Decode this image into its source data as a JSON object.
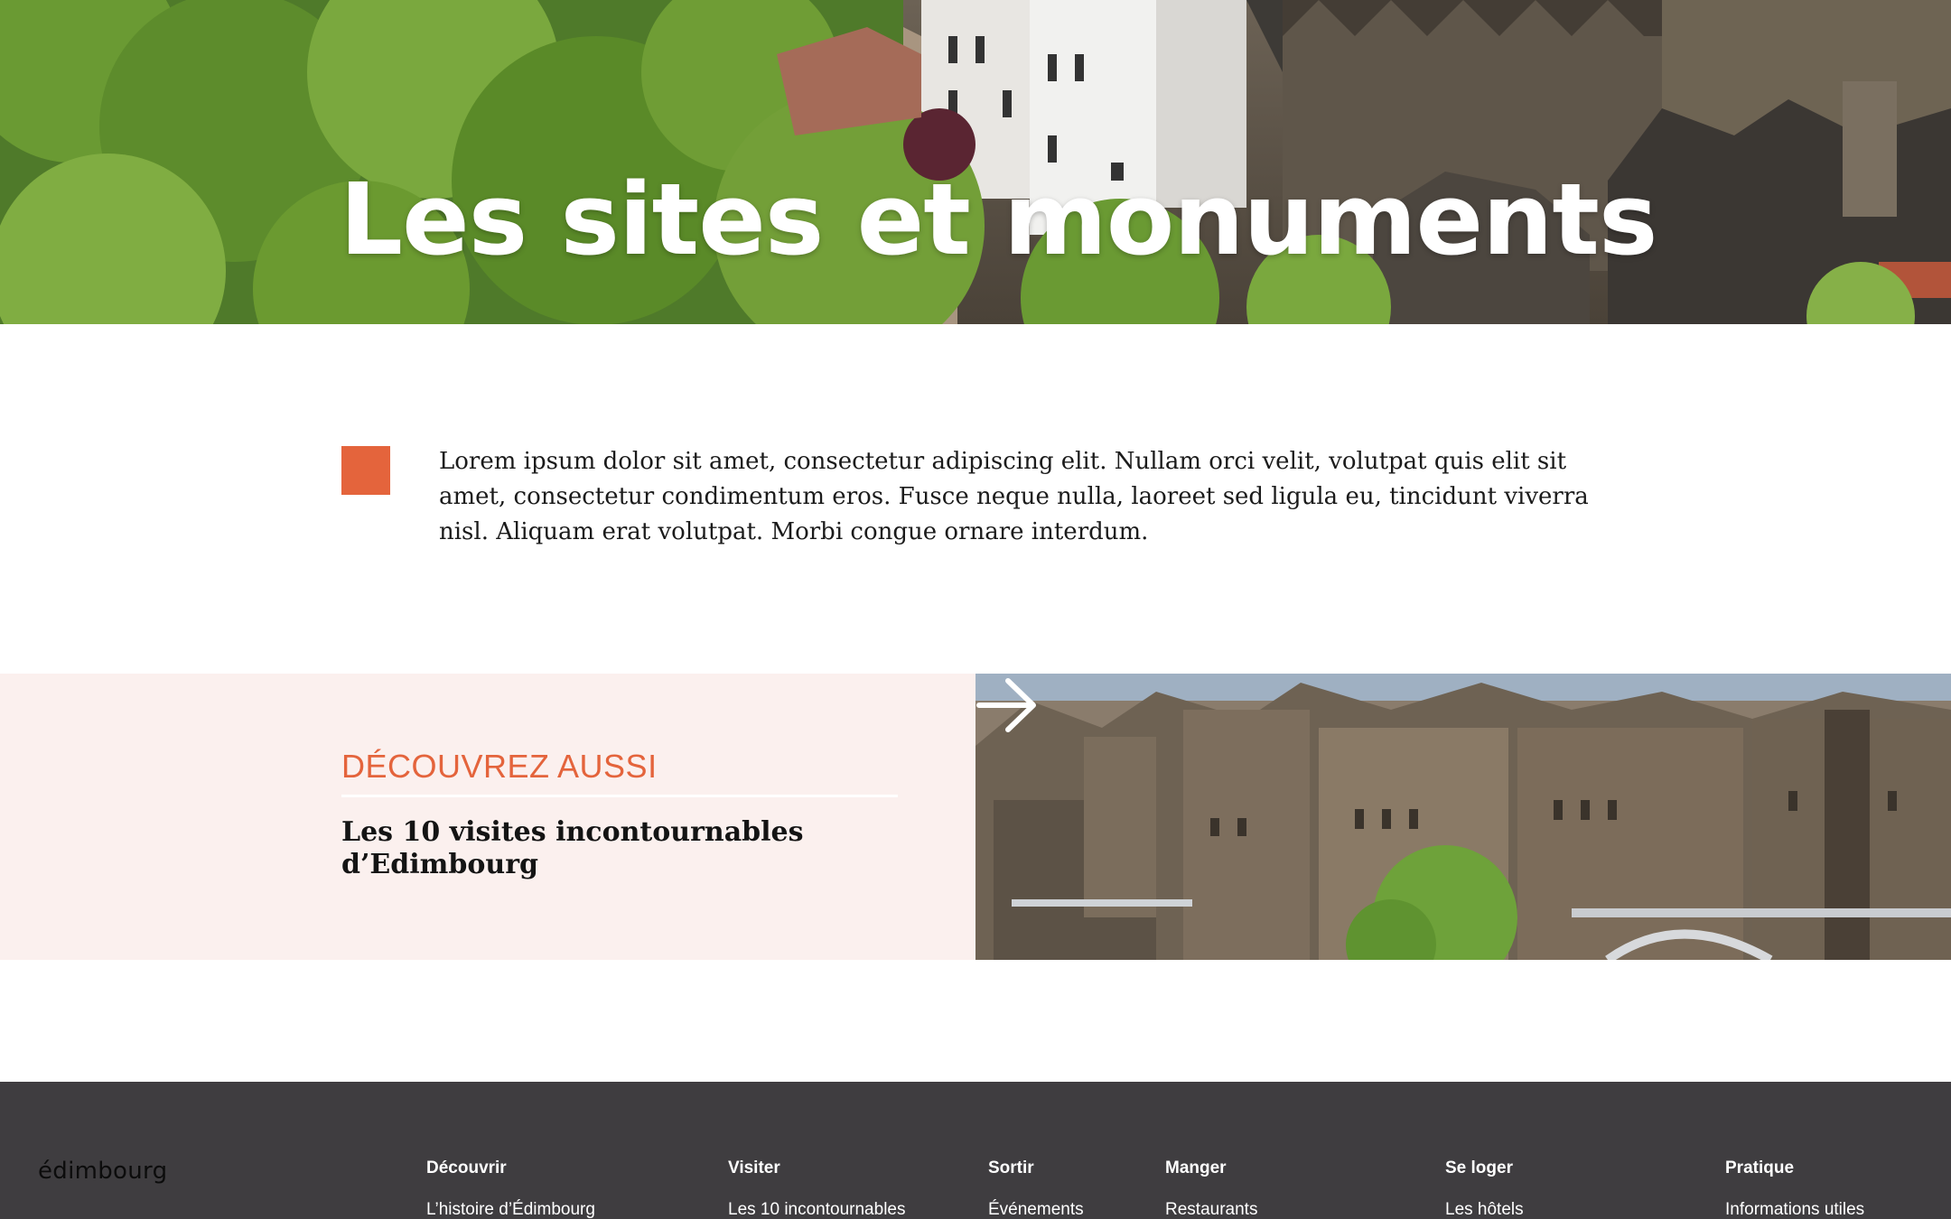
{
  "hero": {
    "title": "Les sites et monuments"
  },
  "intro": {
    "text": "Lorem ipsum dolor sit amet, consectetur adipiscing elit. Nullam orci velit, volutpat quis elit sit amet, consectetur condimentum eros. Fusce neque nulla, laoreet sed ligula eu, tincidunt viverra nisl. Aliquam erat volutpat. Morbi congue ornare interdum.",
    "accent_color": "#e4643c"
  },
  "discover": {
    "kicker": "DÉCOUVREZ AUSSI",
    "title": "Les 10 visites incontournables d’Edimbourg",
    "background": "#fbf0ee",
    "arrow_icon": "arrow-right-icon"
  },
  "footer": {
    "logo": "édimbourg",
    "background": "#3f3d40",
    "columns": [
      {
        "title": "Découvrir",
        "link": "L’histoire d’Édimbourg"
      },
      {
        "title": "Visiter",
        "link": "Les 10 incontournables"
      },
      {
        "title": "Sortir",
        "link": "Événements"
      },
      {
        "title": "Manger",
        "link": "Restaurants"
      },
      {
        "title": "Se loger",
        "link": "Les hôtels"
      },
      {
        "title": "Pratique",
        "link": "Informations utiles"
      }
    ]
  }
}
